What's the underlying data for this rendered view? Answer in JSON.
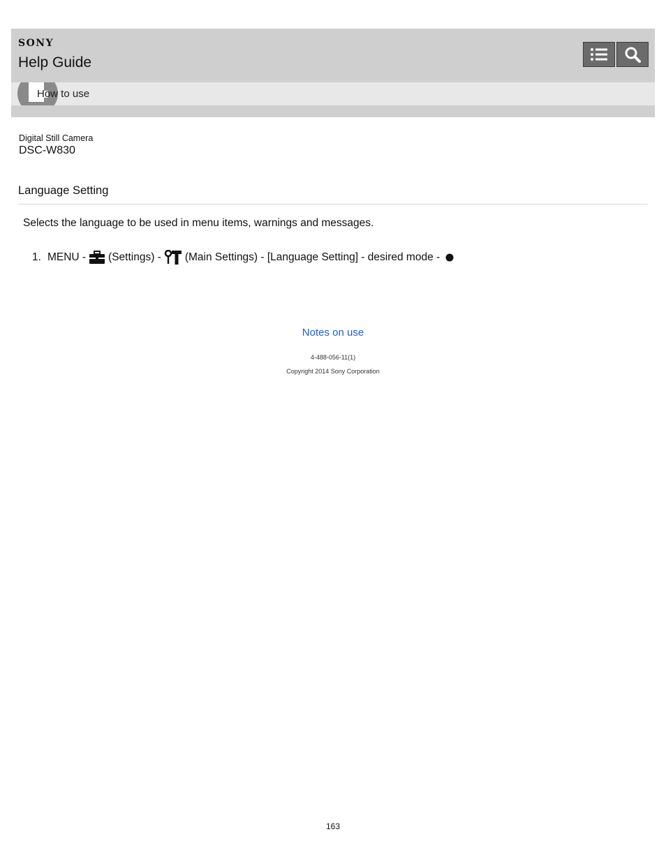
{
  "header": {
    "brand": "SONY",
    "title": "Help Guide",
    "toc_icon": "list-icon",
    "search_icon": "search-icon"
  },
  "subbar": {
    "label": "How to use",
    "icon": "how-to-use-icon"
  },
  "product": {
    "category": "Digital Still Camera",
    "model": "DSC-W830"
  },
  "article": {
    "title": "Language Setting",
    "description": "Selects the language to be used in menu items, warnings and messages.",
    "steps": [
      {
        "number": "1.",
        "parts": [
          "MENU -",
          "(Settings) -",
          "(Main Settings) - [Language Setting] - desired mode -"
        ],
        "icons": [
          "settings-toolbox-icon",
          "main-settings-tools-icon",
          "center-button-icon"
        ]
      }
    ]
  },
  "footer": {
    "link": "Notes on use",
    "code": "4-488-056-11(1)",
    "copyright": "Copyright 2014 Sony Corporation",
    "page_number": "163"
  },
  "colors": {
    "header_bg": "#cfcfcf",
    "subbar_bg": "#e8e8e8",
    "button_bg": "#6b6b6b",
    "link": "#1a5fd6"
  }
}
